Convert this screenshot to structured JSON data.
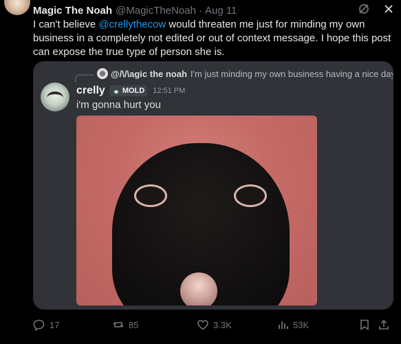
{
  "tweet": {
    "author_name": "Magic The Noah",
    "handle": "@MagicTheNoah",
    "separator": "·",
    "time": "Aug 11",
    "text_before": "I can't believe ",
    "mention": "@crellythecow",
    "text_after": " would threaten me just for minding my own business in a completely not edited or out of context message. I hope this post can expose the true type of person she is."
  },
  "embed": {
    "reply": {
      "username": "@/\\/\\agic the noah",
      "text": "I'm just minding my own business having a nice day"
    },
    "message": {
      "username": "crelly",
      "role": "MOLD",
      "time": "12:51 PM",
      "text": "i'm gonna hurt you"
    }
  },
  "actions": {
    "replies": "17",
    "reposts": "85",
    "likes": "3.3K",
    "views": "53K"
  },
  "icons": {
    "grok": "grok-icon",
    "close": "close-icon",
    "reply": "reply-icon",
    "repost": "repost-icon",
    "like": "heart-icon",
    "views": "views-icon",
    "bookmark": "bookmark-icon",
    "share": "share-icon"
  },
  "colors": {
    "background": "#000000",
    "text": "#e7e9ea",
    "muted": "#71767b",
    "link": "#1d9bf0",
    "discord_bg": "#313338",
    "image_red": "#c56b67"
  }
}
